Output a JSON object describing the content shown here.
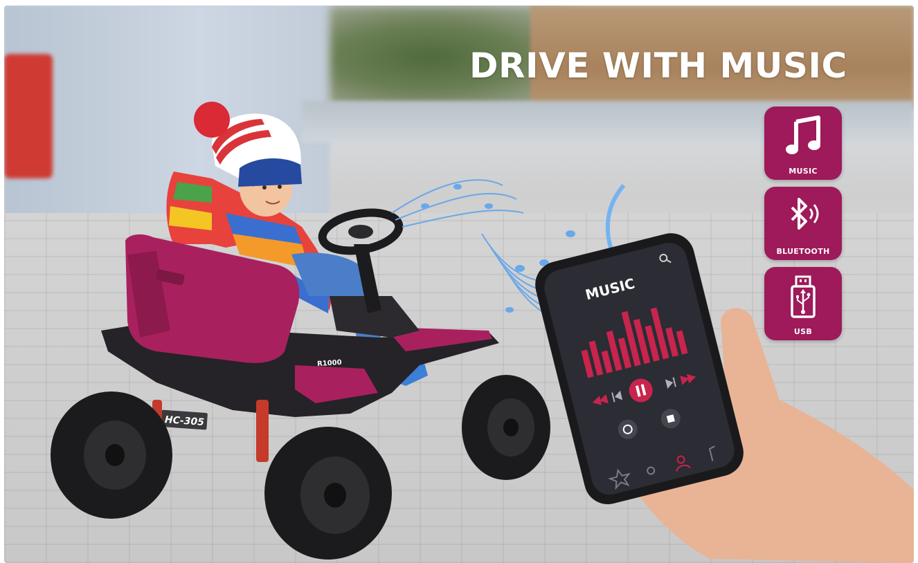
{
  "headline": "DRIVE WITH MUSIC",
  "features": [
    {
      "label": "MUSIC",
      "icon": "music-note-icon"
    },
    {
      "label": "BLUETOOTH",
      "icon": "bluetooth-icon"
    },
    {
      "label": "USB",
      "icon": "usb-icon"
    }
  ],
  "vehicle": {
    "badge": "HC-305",
    "logo": "R1000"
  },
  "phone": {
    "screen_title": "MUSIC"
  },
  "colors": {
    "accent": "#9e1a5a",
    "vehicle_pink": "#a8215e",
    "equalizer": "#c9244d"
  }
}
